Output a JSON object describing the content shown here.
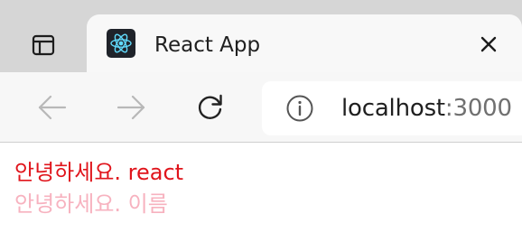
{
  "tab": {
    "title": "React App",
    "favicon_icon": "react-logo-icon",
    "close_icon": "close-icon"
  },
  "tab_actions": {
    "icon": "tab-actions-icon"
  },
  "toolbar": {
    "back_icon": "arrow-left-icon",
    "forward_icon": "arrow-right-icon",
    "reload_icon": "reload-icon",
    "info_icon": "info-icon",
    "url_host": "localhost",
    "url_port": ":3000"
  },
  "content": {
    "greeting_1": "안녕하세요. react",
    "greeting_2": "안녕하세요. 이름"
  },
  "colors": {
    "greeting_1": "#e0141b",
    "greeting_2": "#f7b2bf",
    "react": "#61dafb"
  }
}
